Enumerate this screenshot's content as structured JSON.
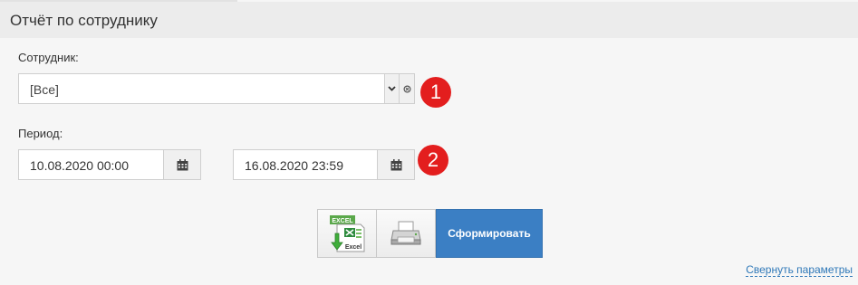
{
  "header": {
    "title": "Отчёт по сотруднику"
  },
  "employee": {
    "label": "Сотрудник:",
    "value": "[Все]",
    "badge": "1"
  },
  "period": {
    "label": "Период:",
    "from": "10.08.2020 00:00",
    "to": "16.08.2020 23:59",
    "badge": "2"
  },
  "actions": {
    "excel_text_top": "EXCEL",
    "excel_text_bottom": "Excel",
    "generate_label": "Сформировать"
  },
  "footer": {
    "collapse_label": "Свернуть параметры"
  },
  "colors": {
    "accent": "#3b7fc4",
    "badge": "#e31e1e",
    "excel_green": "#2e8b3e"
  },
  "icons": [
    "chevron-down-icon",
    "clear-icon",
    "calendar-icon",
    "excel-icon",
    "printer-icon"
  ]
}
